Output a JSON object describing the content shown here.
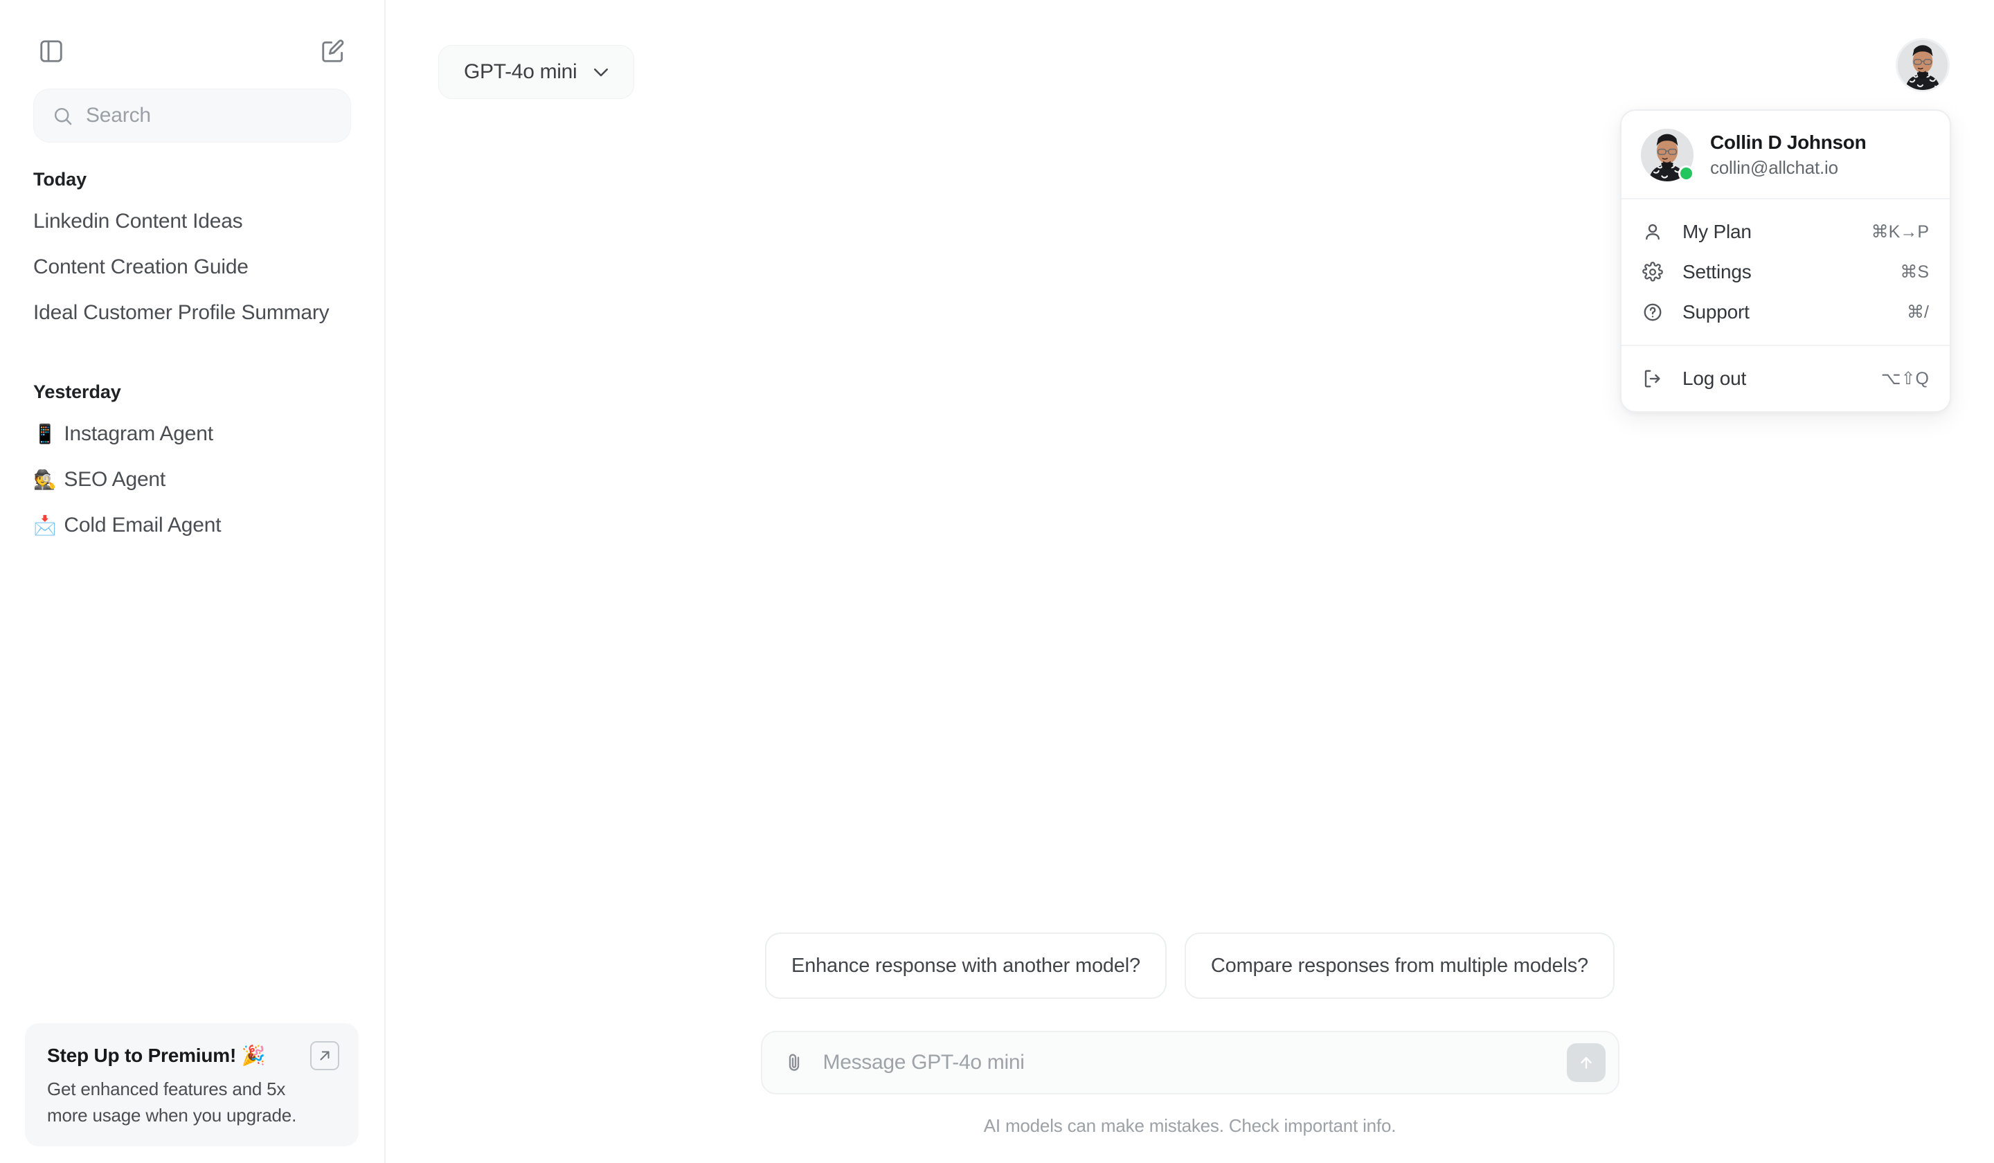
{
  "sidebar": {
    "toggle_icon": "panel-toggle-icon",
    "compose_icon": "edit-square-icon",
    "search": {
      "placeholder": "Search",
      "value": "",
      "icon": "search-icon"
    },
    "groups": [
      {
        "label": "Today",
        "items": [
          {
            "emoji": "",
            "label": "Linkedin Content Ideas"
          },
          {
            "emoji": "",
            "label": "Content Creation Guide"
          },
          {
            "emoji": "",
            "label": "Ideal Customer Profile Summary"
          }
        ]
      },
      {
        "label": "Yesterday",
        "items": [
          {
            "emoji": "📱",
            "label": "Instagram Agent"
          },
          {
            "emoji": "🕵️",
            "label": "SEO Agent"
          },
          {
            "emoji": "📩",
            "label": "Cold Email Agent"
          }
        ]
      }
    ],
    "promo": {
      "title": "Step Up to Premium! 🎉",
      "subtitle": "Get enhanced features and 5x more usage when you upgrade.",
      "open_icon": "arrow-up-right-icon"
    }
  },
  "header": {
    "model_selector": {
      "label": "GPT-4o mini",
      "chevron_icon": "chevron-down-icon"
    },
    "avatar_alt": "Collin D Johnson"
  },
  "user_menu": {
    "name": "Collin D Johnson",
    "email": "collin@allchat.io",
    "status_color": "#22c55e",
    "sections": [
      {
        "items": [
          {
            "icon": "user-icon",
            "label": "My Plan",
            "shortcut": "⌘K→P"
          },
          {
            "icon": "gear-icon",
            "label": "Settings",
            "shortcut": "⌘S"
          },
          {
            "icon": "question-circle-icon",
            "label": "Support",
            "shortcut": "⌘/"
          }
        ]
      },
      {
        "items": [
          {
            "icon": "logout-icon",
            "label": "Log out",
            "shortcut": "⌥⇧Q"
          }
        ]
      }
    ]
  },
  "composer": {
    "suggestions": [
      "Enhance response with another model?",
      "Compare responses from multiple models?"
    ],
    "attach_icon": "paperclip-icon",
    "placeholder": "Message GPT-4o mini",
    "value": "",
    "send_icon": "arrow-up-icon",
    "disclaimer": "AI models can make mistakes. Check important info."
  },
  "colors": {
    "accent_status": "#22c55e",
    "surface": "#ffffff",
    "muted_surface": "#f7f8f9",
    "border": "#eef0f2",
    "text_primary": "#17191c",
    "text_secondary": "#4a4e52",
    "text_muted": "#9aa0a6"
  }
}
